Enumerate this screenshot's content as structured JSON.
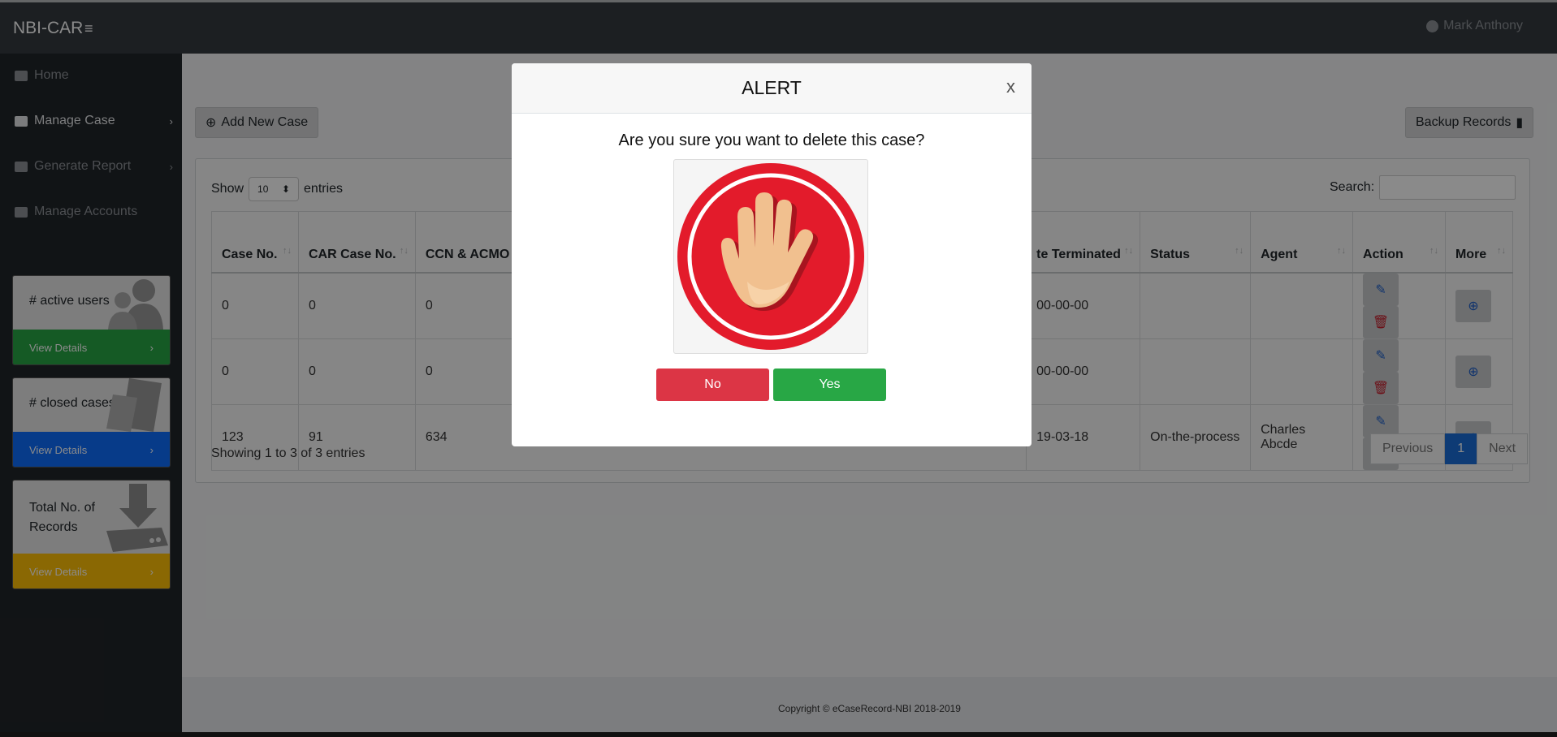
{
  "navbar": {
    "brand": "NBI-CAR",
    "menu_icon": "bars-icon",
    "user": "Mark Anthony",
    "user_icon": "user-circle-icon"
  },
  "sidebar": {
    "items": [
      {
        "label": "Home",
        "icon": "home-icon"
      },
      {
        "label": "Manage Case",
        "icon": "briefcase-icon",
        "chevron": "›"
      },
      {
        "label": "Generate Report",
        "icon": "briefcase-icon",
        "chevron": "›"
      },
      {
        "label": "Manage Accounts",
        "icon": "user-cog-icon"
      }
    ],
    "cards": [
      {
        "title": "# active users",
        "link": "View Details",
        "color": "#28a745",
        "art": "users-icon"
      },
      {
        "title": "# closed cases",
        "link": "View Details",
        "color": "#0d6efd",
        "art": "folder-icon"
      },
      {
        "title": "Total No. of Records",
        "link": "View Details",
        "color": "#ffc107",
        "art": "download-icon"
      }
    ]
  },
  "main": {
    "add_button": "Add New Case",
    "backup_button": "Backup Records",
    "show_label": "Show",
    "entries_value": "10",
    "entries_label": "entries",
    "search_label": "Search:",
    "table": {
      "headers": [
        "Case No.",
        "CAR Case No.",
        "CCN & ACMO",
        "te Terminated",
        "Status",
        "Agent",
        "Action",
        "More"
      ],
      "rows": [
        [
          "0",
          "0",
          "0",
          "00-00-00",
          "",
          ""
        ],
        [
          "0",
          "0",
          "0",
          "00-00-00",
          "",
          ""
        ],
        [
          "123",
          "91",
          "634",
          "19-03-18",
          "On-the-process",
          "Charles Abcde"
        ]
      ]
    },
    "showing": "Showing 1 to 3 of 3 entries",
    "pagination": {
      "prev": "Previous",
      "current": "1",
      "next": "Next"
    }
  },
  "footer": {
    "text": "Copyright © eCaseRecord-NBI 2018-2019"
  },
  "modal": {
    "title": "ALERT",
    "close": "x",
    "message": "Are you sure you want to delete this case?",
    "image": "stop-hand-icon",
    "no_label": "No",
    "yes_label": "Yes"
  }
}
